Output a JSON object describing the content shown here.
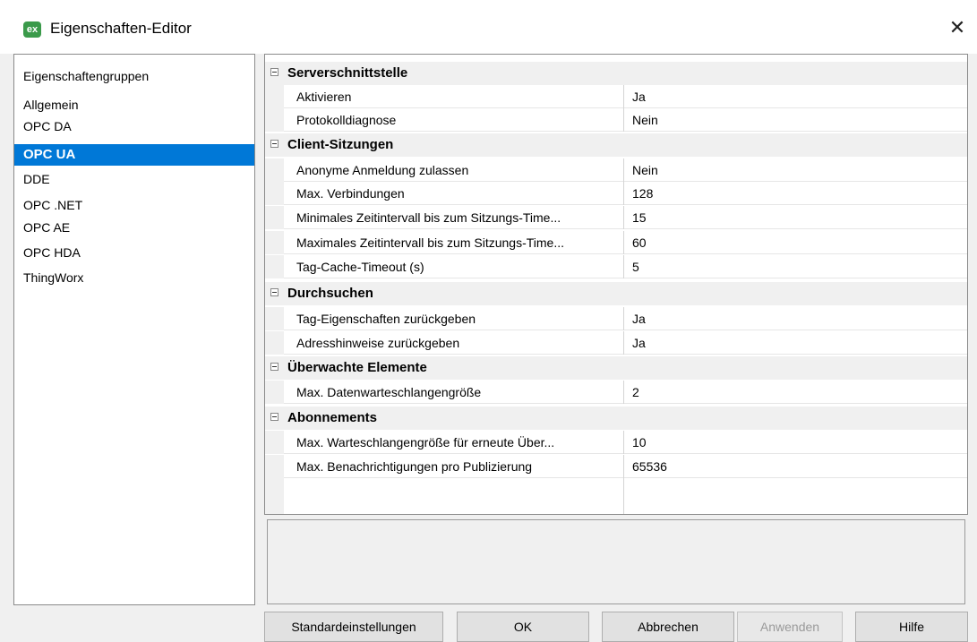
{
  "window": {
    "title": "Eigenschaften-Editor",
    "icon_text": "ex",
    "close_glyph": "✕"
  },
  "groups": {
    "header": "Eigenschaftengruppen",
    "items": [
      {
        "label": "Allgemein",
        "selected": false
      },
      {
        "label": "OPC DA",
        "selected": false
      },
      {
        "label": "OPC UA",
        "selected": true
      },
      {
        "label": "DDE",
        "selected": false
      },
      {
        "label": "OPC .NET",
        "selected": false
      },
      {
        "label": "OPC AE",
        "selected": false
      },
      {
        "label": "OPC HDA",
        "selected": false
      },
      {
        "label": "ThingWorx",
        "selected": false
      }
    ]
  },
  "grid": {
    "categories": [
      {
        "name": "Serverschnittstelle",
        "properties": [
          {
            "name": "Aktivieren",
            "value": "Ja"
          },
          {
            "name": "Protokolldiagnose",
            "value": "Nein"
          }
        ]
      },
      {
        "name": "Client-Sitzungen",
        "properties": [
          {
            "name": "Anonyme Anmeldung zulassen",
            "value": "Nein"
          },
          {
            "name": "Max. Verbindungen",
            "value": "128"
          },
          {
            "name": "Minimales Zeitintervall bis zum Sitzungs-Time...",
            "value": "15"
          },
          {
            "name": "Maximales Zeitintervall bis zum Sitzungs-Time...",
            "value": "60"
          },
          {
            "name": "Tag-Cache-Timeout (s)",
            "value": "5"
          }
        ]
      },
      {
        "name": "Durchsuchen",
        "properties": [
          {
            "name": "Tag-Eigenschaften zurückgeben",
            "value": "Ja"
          },
          {
            "name": "Adresshinweise zurückgeben",
            "value": "Ja"
          }
        ]
      },
      {
        "name": "Überwachte Elemente",
        "properties": [
          {
            "name": "Max. Datenwarteschlangengröße",
            "value": "2"
          }
        ]
      },
      {
        "name": "Abonnements",
        "properties": [
          {
            "name": "Max. Warteschlangengröße für erneute Über...",
            "value": "10"
          },
          {
            "name": "Max. Benachrichtigungen pro Publizierung",
            "value": "65536"
          }
        ]
      }
    ]
  },
  "buttons": {
    "defaults": "Standardeinstellungen",
    "ok": "OK",
    "cancel": "Abbrechen",
    "apply": "Anwenden",
    "help": "Hilfe"
  },
  "colors": {
    "selection": "#0078d7",
    "window_bg": "#f0f0f0",
    "app_icon": "#3a9a4a"
  }
}
